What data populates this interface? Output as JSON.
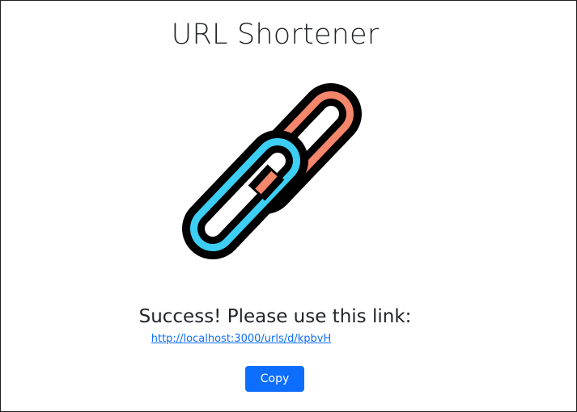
{
  "page": {
    "title": "URL Shortener"
  },
  "logo": {
    "icon": "chain-link-icon",
    "colors": {
      "outline": "#000000",
      "back_link": "#f4866b",
      "front_link": "#3ccff3"
    }
  },
  "result": {
    "message": "Success! Please use this link:",
    "link_text": "http://localhost:3000/urls/d/kpbvH"
  },
  "actions": {
    "copy_label": "Copy",
    "primary_color": "#0d6efd"
  }
}
